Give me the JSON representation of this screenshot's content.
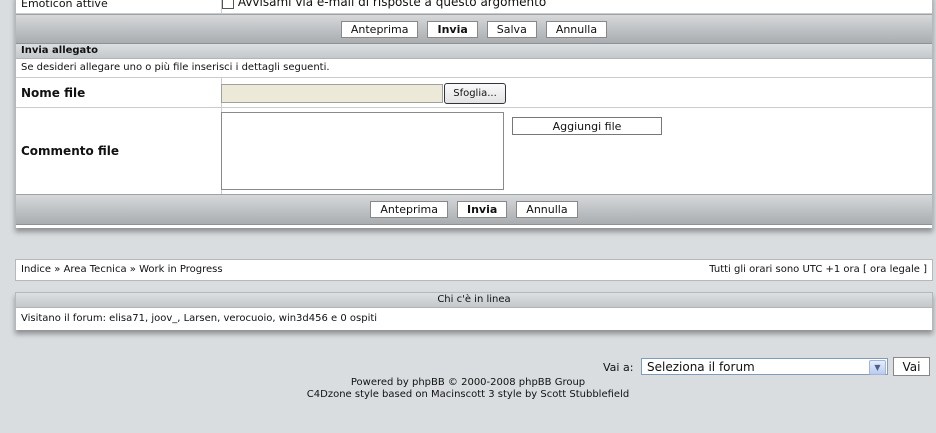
{
  "top_form": {
    "emoticon_label": "Emoticon attive",
    "notify_label": "Avvisami via e-mail di risposte a questo argomento",
    "buttons": {
      "preview": "Anteprima",
      "submit": "Invia",
      "save": "Salva",
      "cancel": "Annulla"
    }
  },
  "attachment": {
    "header": "Invia allegato",
    "description": "Se desideri allegare uno o più file inserisci i dettagli seguenti.",
    "filename_label": "Nome file",
    "browse_label": "Sfoglia...",
    "comment_label": "Commento file",
    "add_file_label": "Aggiungi file",
    "buttons": {
      "preview": "Anteprima",
      "submit": "Invia",
      "cancel": "Annulla"
    }
  },
  "breadcrumb": {
    "items": [
      "Indice",
      "Area Tecnica",
      "Work in Progress"
    ],
    "separator": "»",
    "timezone_prefix": "Tutti gli orari sono UTC +1 ora [",
    "timezone_link": "ora legale",
    "timezone_suffix": "]"
  },
  "online": {
    "header": "Chi c'è in linea",
    "text": "Visitano il forum: elisa71, joov_, Larsen, verocuoio, win3d456 e 0 ospiti"
  },
  "jump": {
    "label": "Vai a:",
    "selected": "Seleziona il forum",
    "button": "Vai"
  },
  "footer": {
    "line1": "Powered by phpBB © 2000-2008 phpBB Group",
    "line2": "C4Dzone style based on Macinscott 3 style by Scott Stubblefield"
  }
}
